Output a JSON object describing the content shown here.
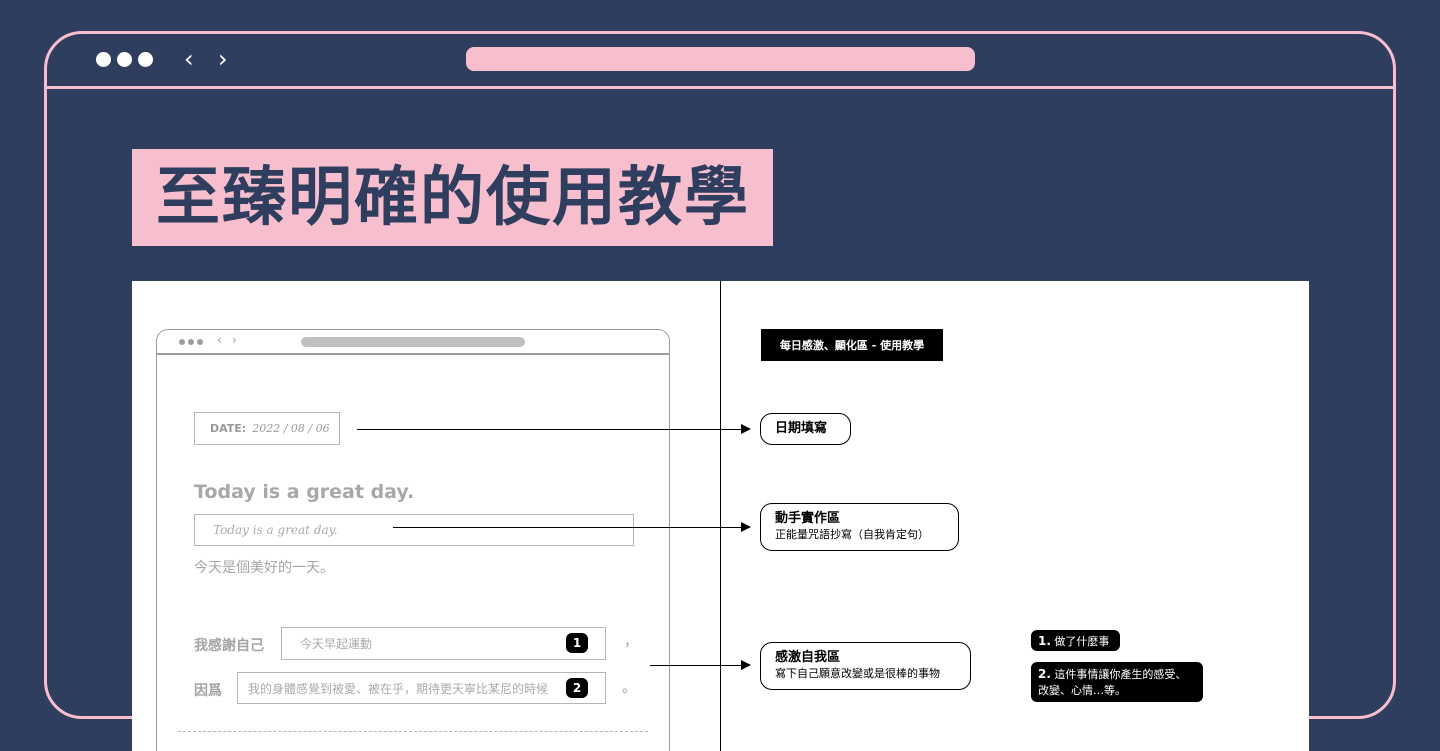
{
  "browser": {
    "back_glyph": "‹",
    "forward_glyph": "›"
  },
  "headline": "至臻明確的使用教學",
  "mockup": {
    "date_label": "DATE:",
    "date_value": "2022 / 08 / 06",
    "affirmation_heading": "Today is a great day.",
    "affirmation_input": "Today is a great day.",
    "affirmation_translation": "今天是個美好的一天。",
    "gratitude_label": "我感謝自己",
    "gratitude_value": "今天早起運動",
    "gratitude_badge": "1",
    "gratitude_punct": "，",
    "because_label": "因爲",
    "because_value": "我的身體感覺到被愛、被在乎，期待更天寧比某尼的時候",
    "because_badge": "2",
    "because_punct": "。"
  },
  "guide": {
    "section_tag": "每日感激、顯化區 - 使用教學",
    "callouts": [
      {
        "title": "日期填寫",
        "subtitle": ""
      },
      {
        "title": "動手實作區",
        "subtitle": "正能量咒語抄寫（自我肯定句）"
      },
      {
        "title": "感激自我區",
        "subtitle": "寫下自己願意改變或是很棒的事物"
      }
    ],
    "tips": [
      {
        "num": "1.",
        "text": "做了什麼事"
      },
      {
        "num": "2.",
        "text": "這件事情讓你產生的感受、改變、心情…等。"
      }
    ]
  },
  "colors": {
    "background": "#2f3e5e",
    "accent_pink": "#f7bfcd",
    "panel": "#ffffff"
  }
}
